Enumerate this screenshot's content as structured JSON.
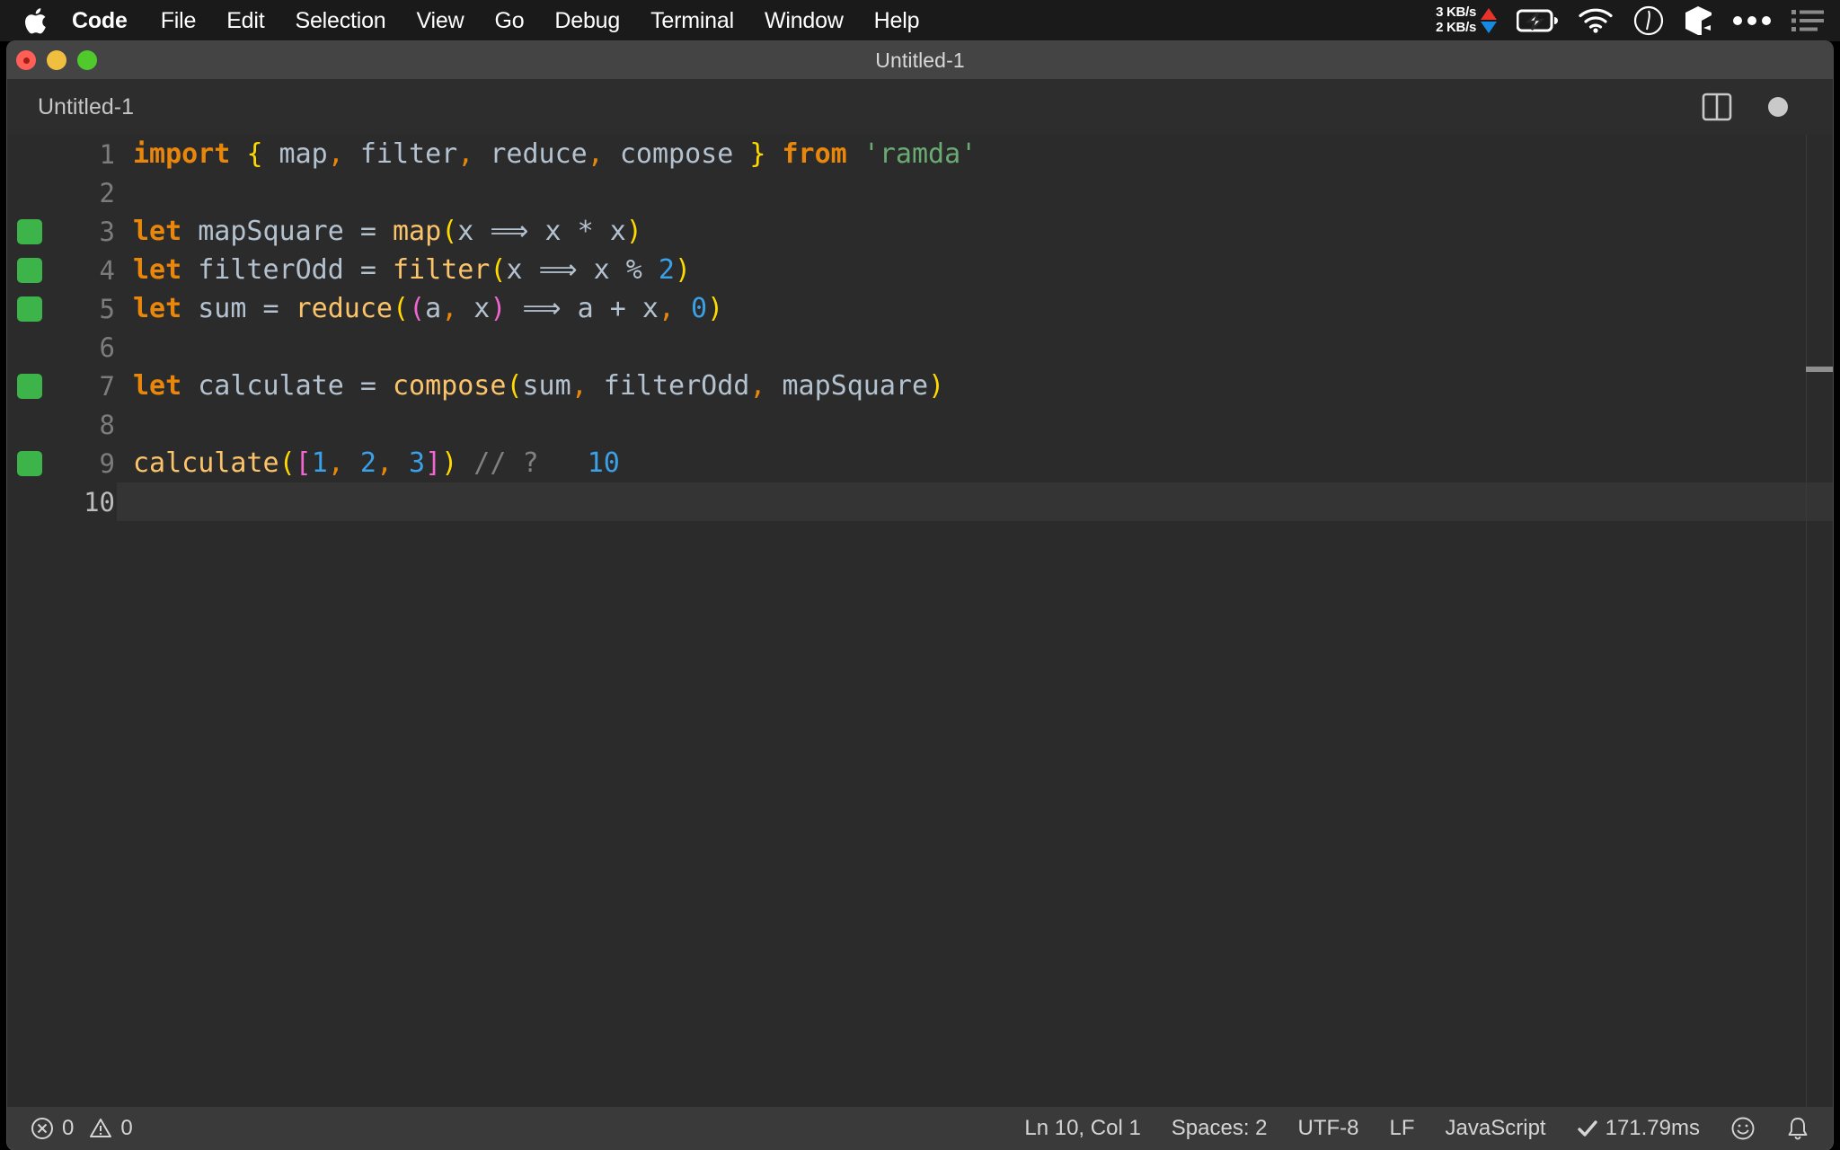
{
  "menubar": {
    "apple_icon": "apple-logo-icon",
    "items": [
      {
        "label": "Code",
        "bold": true
      },
      {
        "label": "File"
      },
      {
        "label": "Edit"
      },
      {
        "label": "Selection"
      },
      {
        "label": "View"
      },
      {
        "label": "Go"
      },
      {
        "label": "Debug"
      },
      {
        "label": "Terminal"
      },
      {
        "label": "Window"
      },
      {
        "label": "Help"
      }
    ],
    "status": {
      "upload_speed": "3 KB/s",
      "download_speed": "2 KB/s",
      "upload_color": "#e8332a",
      "download_color": "#1789e0",
      "icons": [
        "battery-charging-icon",
        "wifi-icon",
        "clock-icon",
        "hexagon-icon",
        "ellipsis-icon",
        "control-center-list-icon"
      ]
    }
  },
  "window": {
    "title": "Untitled-1",
    "traffic_lights": [
      "close-button",
      "minimize-button",
      "maximize-button"
    ]
  },
  "tabbar": {
    "tabs": [
      {
        "label": "Untitled-1",
        "active": true,
        "dirty": true
      }
    ],
    "actions": [
      "split-editor-icon",
      "unsaved-indicator-dot"
    ]
  },
  "editor": {
    "language": "JavaScript",
    "active_line": 10,
    "lines": [
      {
        "number": "1",
        "marker": false,
        "tokens": [
          {
            "text": "import ",
            "class": "t-kw"
          },
          {
            "text": "{",
            "class": "t-brace"
          },
          {
            "text": " map",
            "class": "t-id"
          },
          {
            "text": ",",
            "class": "t-comma"
          },
          {
            "text": " filter",
            "class": "t-id"
          },
          {
            "text": ",",
            "class": "t-comma"
          },
          {
            "text": " reduce",
            "class": "t-id"
          },
          {
            "text": ",",
            "class": "t-comma"
          },
          {
            "text": " compose ",
            "class": "t-id"
          },
          {
            "text": "}",
            "class": "t-brace"
          },
          {
            "text": " from ",
            "class": "t-kw"
          },
          {
            "text": "'ramda'",
            "class": "t-str"
          }
        ]
      },
      {
        "number": "2",
        "marker": false,
        "tokens": []
      },
      {
        "number": "3",
        "marker": true,
        "tokens": [
          {
            "text": "let ",
            "class": "t-kw"
          },
          {
            "text": "mapSquare ",
            "class": "t-id"
          },
          {
            "text": "= ",
            "class": "t-op"
          },
          {
            "text": "map",
            "class": "t-fn"
          },
          {
            "text": "(",
            "class": "t-paren"
          },
          {
            "text": "x ",
            "class": "t-id"
          },
          {
            "text": "⟹",
            "class": "t-arrow"
          },
          {
            "text": " x ",
            "class": "t-id"
          },
          {
            "text": "* ",
            "class": "t-op"
          },
          {
            "text": "x",
            "class": "t-id"
          },
          {
            "text": ")",
            "class": "t-paren"
          }
        ]
      },
      {
        "number": "4",
        "marker": true,
        "tokens": [
          {
            "text": "let ",
            "class": "t-kw"
          },
          {
            "text": "filterOdd ",
            "class": "t-id"
          },
          {
            "text": "= ",
            "class": "t-op"
          },
          {
            "text": "filter",
            "class": "t-fn"
          },
          {
            "text": "(",
            "class": "t-paren"
          },
          {
            "text": "x ",
            "class": "t-id"
          },
          {
            "text": "⟹",
            "class": "t-arrow"
          },
          {
            "text": " x ",
            "class": "t-id"
          },
          {
            "text": "% ",
            "class": "t-op"
          },
          {
            "text": "2",
            "class": "t-num"
          },
          {
            "text": ")",
            "class": "t-paren"
          }
        ]
      },
      {
        "number": "5",
        "marker": true,
        "tokens": [
          {
            "text": "let ",
            "class": "t-kw"
          },
          {
            "text": "sum ",
            "class": "t-id"
          },
          {
            "text": "= ",
            "class": "t-op"
          },
          {
            "text": "reduce",
            "class": "t-fn"
          },
          {
            "text": "(",
            "class": "t-paren"
          },
          {
            "text": "(",
            "class": "t-paren2"
          },
          {
            "text": "a",
            "class": "t-id"
          },
          {
            "text": ",",
            "class": "t-comma"
          },
          {
            "text": " x",
            "class": "t-id"
          },
          {
            "text": ")",
            "class": "t-paren2"
          },
          {
            "text": " ⟹",
            "class": "t-arrow"
          },
          {
            "text": " a ",
            "class": "t-id"
          },
          {
            "text": "+ ",
            "class": "t-op"
          },
          {
            "text": "x",
            "class": "t-id"
          },
          {
            "text": ",",
            "class": "t-comma"
          },
          {
            "text": " 0",
            "class": "t-num"
          },
          {
            "text": ")",
            "class": "t-paren"
          }
        ]
      },
      {
        "number": "6",
        "marker": false,
        "tokens": []
      },
      {
        "number": "7",
        "marker": true,
        "tokens": [
          {
            "text": "let ",
            "class": "t-kw"
          },
          {
            "text": "calculate ",
            "class": "t-id"
          },
          {
            "text": "= ",
            "class": "t-op"
          },
          {
            "text": "compose",
            "class": "t-fn"
          },
          {
            "text": "(",
            "class": "t-paren"
          },
          {
            "text": "sum",
            "class": "t-id"
          },
          {
            "text": ",",
            "class": "t-comma"
          },
          {
            "text": " filterOdd",
            "class": "t-id"
          },
          {
            "text": ",",
            "class": "t-comma"
          },
          {
            "text": " mapSquare",
            "class": "t-id"
          },
          {
            "text": ")",
            "class": "t-paren"
          }
        ]
      },
      {
        "number": "8",
        "marker": false,
        "tokens": []
      },
      {
        "number": "9",
        "marker": true,
        "tokens": [
          {
            "text": "calculate",
            "class": "t-fn"
          },
          {
            "text": "(",
            "class": "t-paren"
          },
          {
            "text": "[",
            "class": "t-paren2"
          },
          {
            "text": "1",
            "class": "t-num"
          },
          {
            "text": ",",
            "class": "t-comma"
          },
          {
            "text": " 2",
            "class": "t-num"
          },
          {
            "text": ",",
            "class": "t-comma"
          },
          {
            "text": " 3",
            "class": "t-num"
          },
          {
            "text": "]",
            "class": "t-paren2"
          },
          {
            "text": ")",
            "class": "t-paren"
          },
          {
            "text": " // ?",
            "class": "t-comment"
          },
          {
            "text": "   10",
            "class": "t-result"
          }
        ]
      },
      {
        "number": "10",
        "marker": false,
        "active": true,
        "tokens": []
      }
    ]
  },
  "statusbar": {
    "errors": {
      "icon": "error-icon",
      "count": "0"
    },
    "warnings": {
      "icon": "warning-icon",
      "count": "0"
    },
    "cursor_position": "Ln 10, Col 1",
    "indentation": "Spaces: 2",
    "encoding": "UTF-8",
    "line_ending": "LF",
    "language_mode": "JavaScript",
    "run_time": "171.79ms",
    "run_check_icon": "checkmark-icon",
    "feedback_icon": "smiley-icon",
    "notifications_icon": "bell-icon"
  }
}
